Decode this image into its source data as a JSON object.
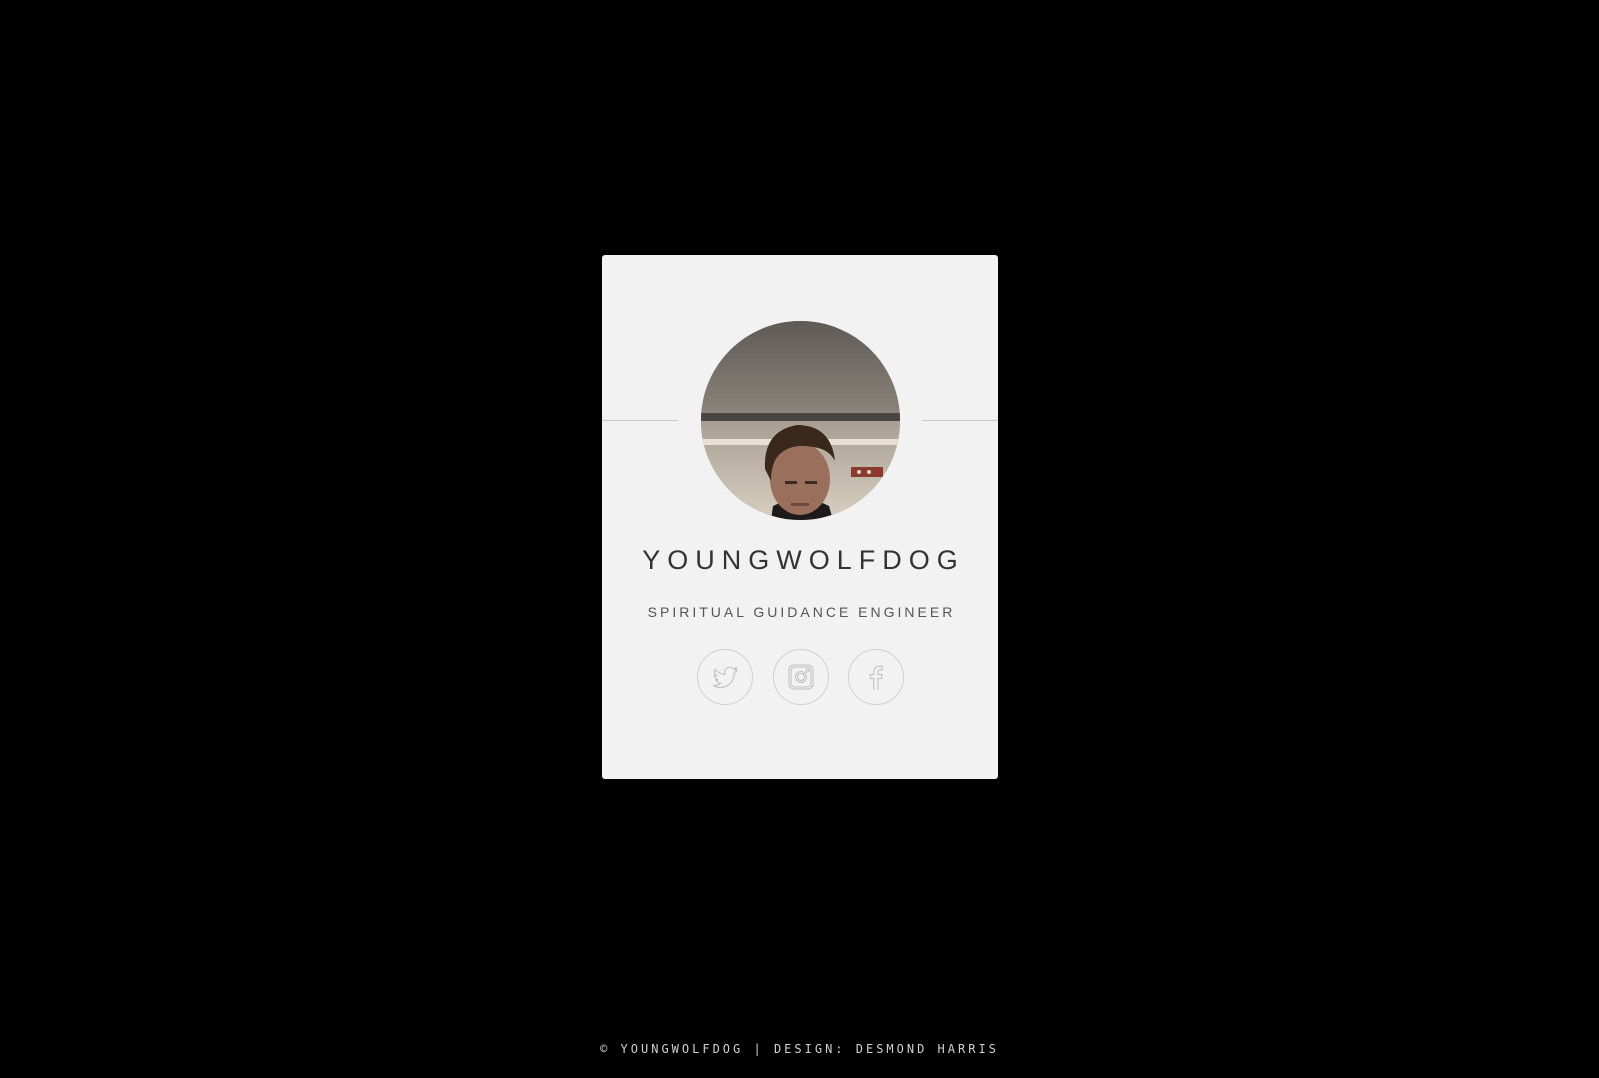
{
  "profile": {
    "name": "YOUNGWOLFDOG",
    "role": "SPIRITUAL GUIDANCE ENGINEER"
  },
  "social": [
    {
      "icon": "twitter-icon"
    },
    {
      "icon": "instagram-icon"
    },
    {
      "icon": "facebook-icon"
    }
  ],
  "footer": {
    "copyright": "© YOUNGWOLFDOG",
    "separator": "|",
    "credit": "DESIGN: DESMOND HARRIS"
  },
  "colors": {
    "background": "#000000",
    "card": "#f2f2f2",
    "text": "#333333",
    "icon_stroke": "#bdbdbd"
  }
}
